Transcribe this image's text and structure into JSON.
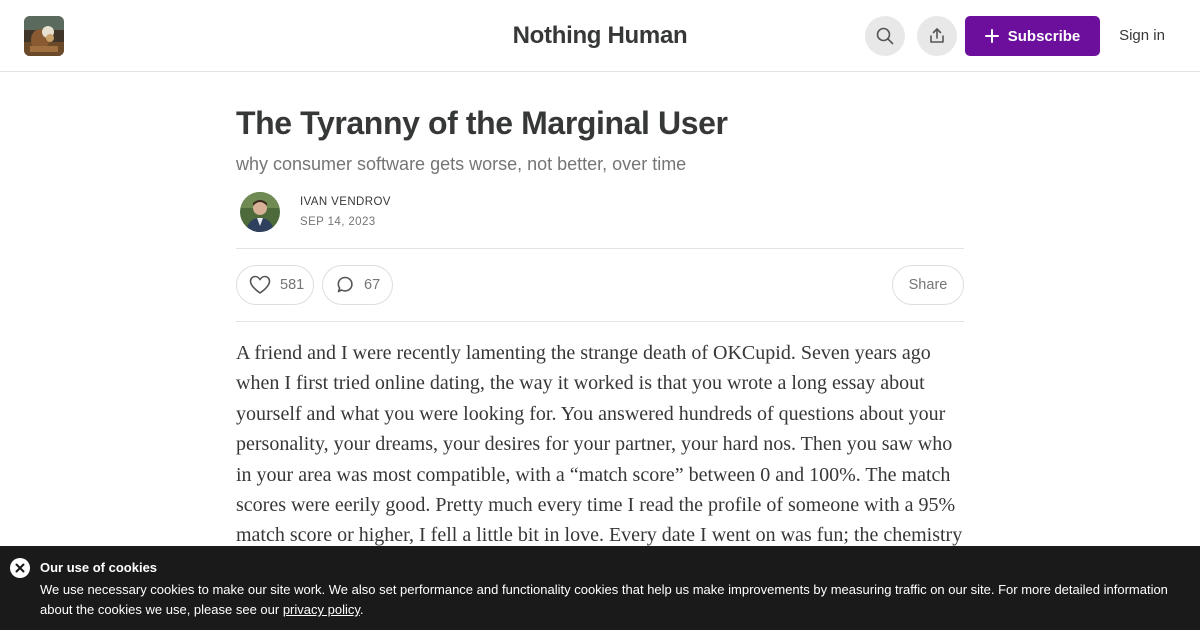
{
  "header": {
    "publication_name": "Nothing Human",
    "subscribe_label": "Subscribe",
    "signin_label": "Sign in",
    "icons": {
      "search": "search-icon",
      "share": "share-upload-icon",
      "subscribe": "plus-icon"
    },
    "accent_color": "#6b0f9c"
  },
  "article": {
    "title": "The Tyranny of the Marginal User",
    "subtitle": "why consumer software gets worse, not better, over time",
    "author": "IVAN VENDROV",
    "date": "SEP 14, 2023",
    "likes": "581",
    "comments": "67",
    "share_label": "Share",
    "body": "A friend and I were recently lamenting the strange death of OKCupid. Seven years ago when I first tried online dating, the way it worked is that you wrote a long essay about yourself and what you were looking for. You answered hundreds of questions about your personality, your dreams, your desires for your partner, your hard nos. Then you saw who in your area was most compatible, with a “match score” between 0 and 100%. The match scores were eerily good. Pretty much every time I read the profile of someone with a 95% match score or higher, I fell a little bit in love. Every date I went on was fun; the chemistry wasn’t always there but I felt like we could at least be great"
  },
  "cookie_banner": {
    "title": "Our use of cookies",
    "text": "We use necessary cookies to make our site work. We also set performance and functionality cookies that help us make improvements by measuring traffic on our site. For more detailed information about the cookies we use, please see our ",
    "link_text": "privacy policy",
    "text_end": "."
  }
}
